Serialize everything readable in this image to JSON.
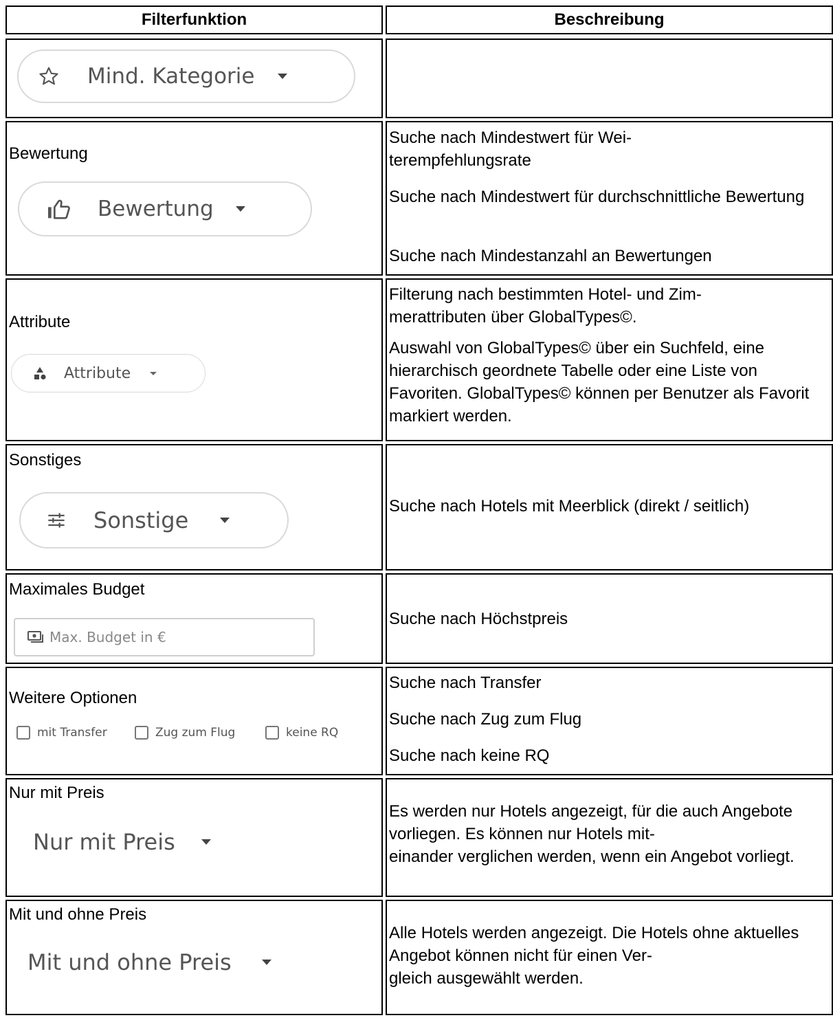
{
  "headers": {
    "filter": "Filterfunktion",
    "description": "Beschreibung"
  },
  "rows": {
    "kategorie": {
      "chip": "Mind. Kategorie",
      "icon": "star-icon"
    },
    "bewertung": {
      "label": "Bewertung",
      "chip": "Bewertung",
      "icon": "thumbs-up-icon",
      "desc": [
        "Suche nach Mindestwert für Wei-\nterempfehlungsrate",
        "Suche nach Mindestwert für durchschnittliche Bewertung",
        "Suche nach Mindestanzahl an Bewertungen"
      ]
    },
    "attribute": {
      "label": "Attribute",
      "chip": "Attribute",
      "icon": "shapes-icon",
      "desc": [
        "Filterung nach bestimmten Hotel- und Zim-\nmerattributen über GlobalTypes©.",
        "Auswahl von GlobalTypes© über ein Suchfeld, eine hierarchisch geordnete Tabelle oder eine Liste von Favoriten. GlobalTypes© können per Benutzer als Favorit markiert werden."
      ]
    },
    "sonstiges": {
      "label": "Sonstiges",
      "chip": "Sonstige",
      "icon": "tune-icon",
      "desc": "Suche nach Hotels mit Meerblick (direkt / seitlich)"
    },
    "budget": {
      "label": "Maximales Budget",
      "placeholder": "Max. Budget in €",
      "icon": "money-icon",
      "desc": "Suche nach Höchstpreis"
    },
    "optionen": {
      "label": "Weitere Optionen",
      "checkboxes": [
        "mit Transfer",
        "Zug zum Flug",
        "keine RQ"
      ],
      "desc": [
        "Suche nach Transfer",
        "Suche nach Zug zum Flug",
        "Suche nach keine RQ"
      ]
    },
    "nur_preis": {
      "label": "Nur mit Preis",
      "dropdown": "Nur mit Preis",
      "desc": "Es werden nur Hotels angezeigt, für die auch Angebote vorliegen. Es können nur Hotels mit-\neinander verglichen werden, wenn ein Angebot vorliegt."
    },
    "mit_ohne": {
      "label": "Mit und ohne Preis",
      "dropdown": "Mit und ohne Preis",
      "desc": "Alle Hotels werden angezeigt. Die Hotels ohne aktuelles Angebot können nicht für einen Ver-\ngleich ausgewählt werden."
    }
  }
}
